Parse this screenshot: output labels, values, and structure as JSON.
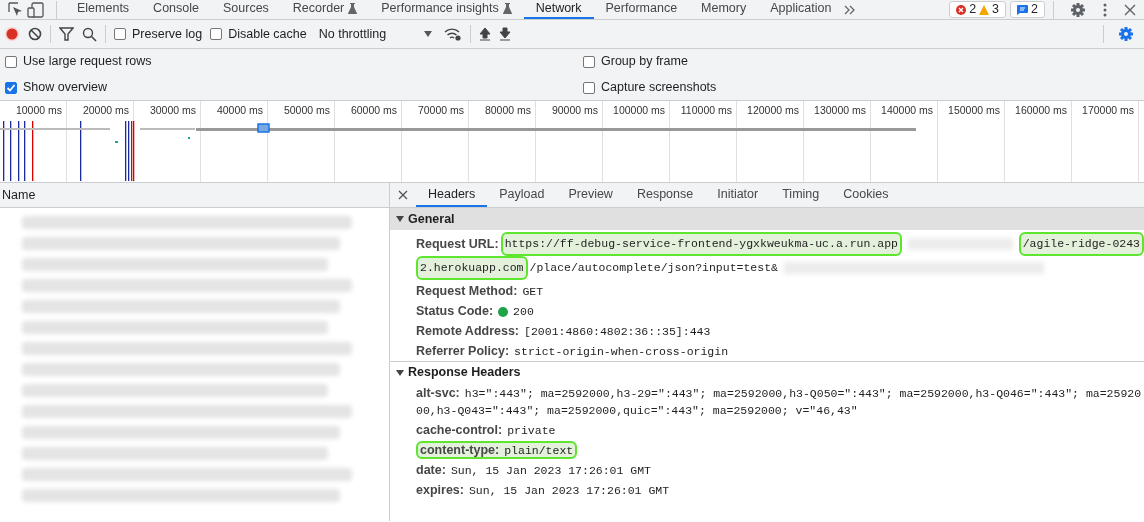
{
  "top_tabs": [
    {
      "label": "Elements",
      "selected": false,
      "experimental": false
    },
    {
      "label": "Console",
      "selected": false,
      "experimental": false
    },
    {
      "label": "Sources",
      "selected": false,
      "experimental": false
    },
    {
      "label": "Recorder",
      "selected": false,
      "experimental": true
    },
    {
      "label": "Performance insights",
      "selected": false,
      "experimental": true
    },
    {
      "label": "Network",
      "selected": true,
      "experimental": false
    },
    {
      "label": "Performance",
      "selected": false,
      "experimental": false
    },
    {
      "label": "Memory",
      "selected": false,
      "experimental": false
    },
    {
      "label": "Application",
      "selected": false,
      "experimental": false
    }
  ],
  "counts": {
    "errors": "2",
    "warnings": "3",
    "messages": "2"
  },
  "toolbar": {
    "recording": true,
    "preserve_log": {
      "label": "Preserve log",
      "checked": false
    },
    "disable_cache": {
      "label": "Disable cache",
      "checked": false
    },
    "throttling": "No throttling"
  },
  "settings": [
    {
      "label": "Use large request rows",
      "checked": false
    },
    {
      "label": "Group by frame",
      "checked": false
    },
    {
      "label": "Show overview",
      "checked": true
    },
    {
      "label": "Capture screenshots",
      "checked": false
    }
  ],
  "overview": {
    "ticks": [
      "10000 ms",
      "20000 ms",
      "30000 ms",
      "40000 ms",
      "50000 ms",
      "60000 ms",
      "70000 ms",
      "80000 ms",
      "90000 ms",
      "100000 ms",
      "110000 ms",
      "120000 ms",
      "130000 ms",
      "140000 ms",
      "150000 ms",
      "160000 ms",
      "170000 ms"
    ]
  },
  "requests": {
    "column": "Name"
  },
  "detail_tabs": [
    {
      "label": "Headers",
      "selected": true
    },
    {
      "label": "Payload",
      "selected": false
    },
    {
      "label": "Preview",
      "selected": false
    },
    {
      "label": "Response",
      "selected": false
    },
    {
      "label": "Initiator",
      "selected": false
    },
    {
      "label": "Timing",
      "selected": false
    },
    {
      "label": "Cookies",
      "selected": false
    }
  ],
  "general": {
    "title": "General",
    "expanded": true,
    "request_url": {
      "name": "Request URL:",
      "lines": [
        [
          {
            "kind": "text",
            "text": "https://ff-debug-service-frontend-ygxkweukma-uc.a.run.app",
            "highlighted": true
          },
          {
            "kind": "redacted"
          },
          {
            "kind": "text",
            "text": "/agile-ridge-0243",
            "highlighted": true
          }
        ],
        [
          {
            "kind": "text",
            "text": "2.herokuapp.com",
            "highlighted": true
          },
          {
            "kind": "text",
            "text": "/place/autocomplete/json?input=test&",
            "highlighted": false
          },
          {
            "kind": "redacted"
          }
        ]
      ]
    },
    "fields": [
      {
        "kind": "plain",
        "name": "Request Method:",
        "value": "GET",
        "highlighted": false
      },
      {
        "kind": "status",
        "name": "Status Code:",
        "value": "200",
        "highlighted": false
      },
      {
        "kind": "plain",
        "name": "Remote Address:",
        "value": "[2001:4860:4802:36::35]:443",
        "highlighted": false
      },
      {
        "kind": "plain",
        "name": "Referrer Policy:",
        "value": "strict-origin-when-cross-origin",
        "highlighted": false
      }
    ]
  },
  "response_headers": {
    "title": "Response Headers",
    "expanded": true,
    "fields": [
      {
        "name": "alt-svc:",
        "value": "h3=\":443\"; ma=2592000,h3-29=\":443\"; ma=2592000,h3-Q050=\":443\"; ma=2592000,h3-Q046=\":443\"; ma=2592000,h3-Q043=\":443\"; ma=2592000,quic=\":443\"; ma=2592000; v=\"46,43\"",
        "highlighted": false
      },
      {
        "name": "cache-control:",
        "value": "private",
        "highlighted": false
      },
      {
        "name": "content-type:",
        "value": "plain/text",
        "highlighted": true
      },
      {
        "name": "date:",
        "value": "Sun, 15 Jan 2023 17:26:01 GMT",
        "highlighted": false
      },
      {
        "name": "expires:",
        "value": "Sun, 15 Jan 2023 17:26:01 GMT",
        "highlighted": false
      }
    ]
  }
}
